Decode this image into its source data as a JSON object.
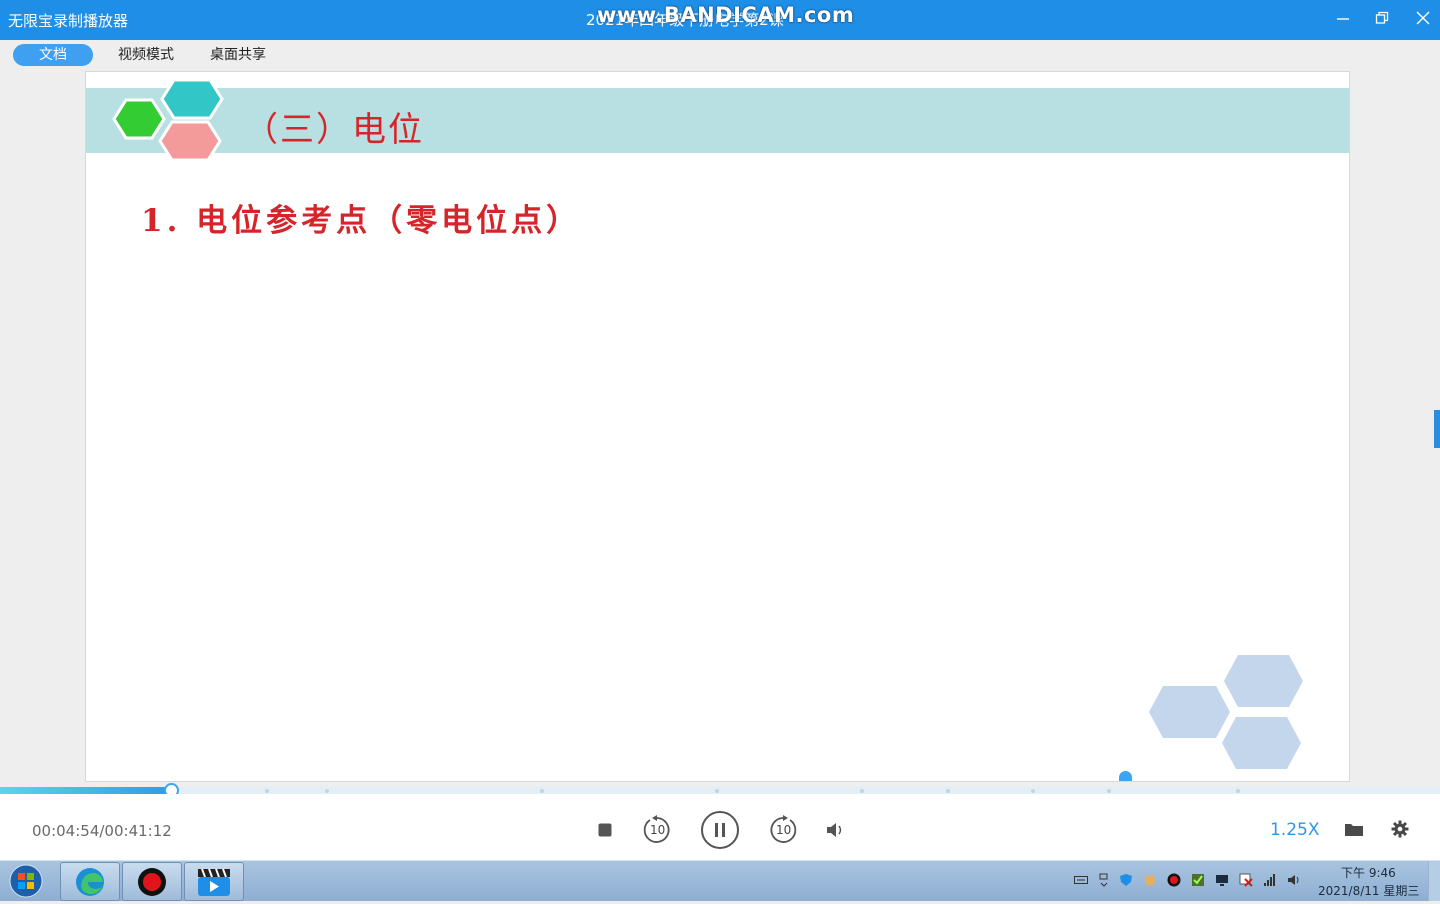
{
  "titlebar": {
    "app_title": "无限宝录制播放器",
    "doc_title": "2021年四年级下册电学第2课",
    "watermark": "www.BANDICAM.com",
    "minimize_icon": "minimize-icon",
    "restore_icon": "restore-icon",
    "close_icon": "close-icon"
  },
  "tabs": [
    {
      "label": "文档",
      "active": true
    },
    {
      "label": "视频模式",
      "active": false
    },
    {
      "label": "桌面共享",
      "active": false
    }
  ],
  "slide": {
    "heading": "（三）电位",
    "item": "1. 电位参考点（零电位点）",
    "colors": {
      "band": "#b8e0e2",
      "text": "#d6252a",
      "hex_green": "#33cc33",
      "hex_teal": "#33c6c6",
      "hex_pink": "#f39a9a",
      "hex_decor": "#c3d6ec"
    }
  },
  "progress": {
    "current": "00:04:54",
    "total": "00:41:12",
    "time_display": "00:04:54/00:41:12",
    "fraction": 0.119
  },
  "controls": {
    "stop_icon": "stop-icon",
    "rewind_label": "10",
    "rewind_icon": "rewind-10-icon",
    "pause_icon": "pause-icon",
    "forward_label": "10",
    "forward_icon": "forward-10-icon",
    "volume_icon": "volume-icon",
    "speed": "1.25X",
    "folder_icon": "folder-icon",
    "settings_icon": "gear-icon"
  },
  "taskbar": {
    "apps": [
      "windows-start-icon",
      "edge-icon",
      "bandicam-record-icon",
      "video-player-icon"
    ],
    "tray": [
      "keyboard-icon",
      "network-icon",
      "shield-icon",
      "cat-icon",
      "record-icon",
      "check-icon",
      "monitor-icon",
      "flag-icon",
      "signal-icon",
      "speaker-icon"
    ],
    "clock_time": "下午 9:46",
    "clock_date": "2021/8/11 星期三"
  },
  "accent_color": "#1e8ee6"
}
